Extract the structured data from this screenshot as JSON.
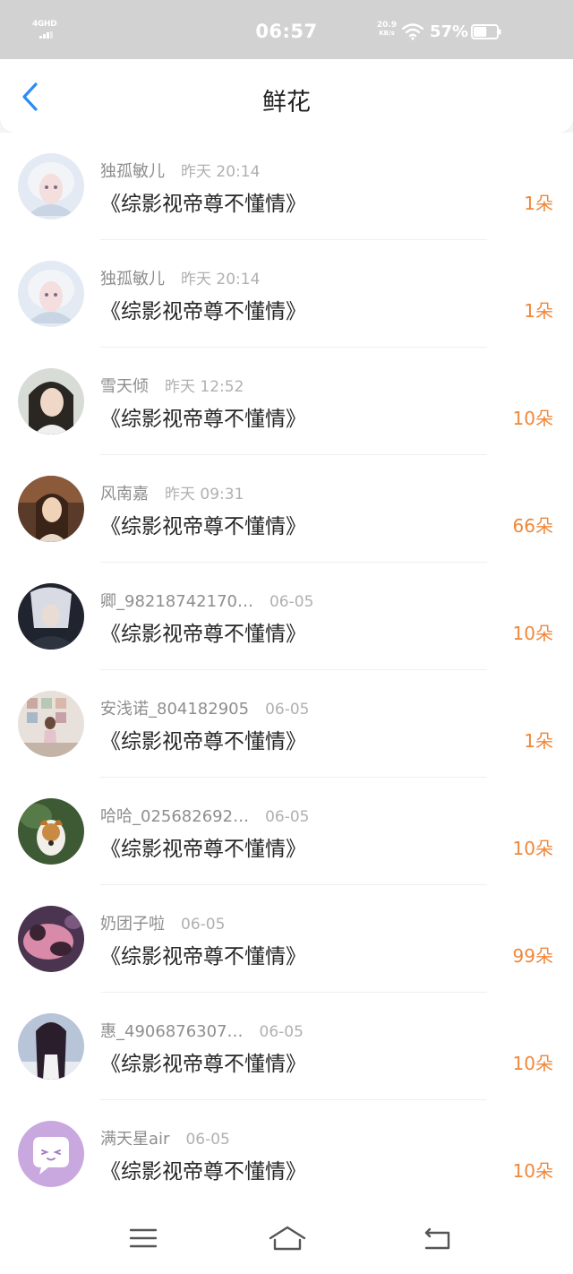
{
  "status_bar": {
    "network": "4GHD",
    "time": "06:57",
    "speed_value": "20.9",
    "speed_unit": "KB/s",
    "battery": "57%",
    "battery_level": 0.57
  },
  "header": {
    "title": "鲜花",
    "back_icon": "chevron-left-icon"
  },
  "colors": {
    "accent_blue": "#2b8cf3",
    "count_orange": "#f0873a"
  },
  "items": [
    {
      "name": "独孤敏儿",
      "time": "昨天 20:14",
      "book": "《综影视帝尊不懂情》",
      "count": "1朵"
    },
    {
      "name": "独孤敏儿",
      "time": "昨天 20:14",
      "book": "《综影视帝尊不懂情》",
      "count": "1朵"
    },
    {
      "name": "雪天倾",
      "time": "昨天 12:52",
      "book": "《综影视帝尊不懂情》",
      "count": "10朵"
    },
    {
      "name": "风南嘉",
      "time": "昨天 09:31",
      "book": "《综影视帝尊不懂情》",
      "count": "66朵"
    },
    {
      "name": "卿_98218742170…",
      "time": "06-05",
      "book": "《综影视帝尊不懂情》",
      "count": "10朵"
    },
    {
      "name": "安浅诺_804182905",
      "time": "06-05",
      "book": "《综影视帝尊不懂情》",
      "count": "1朵"
    },
    {
      "name": "哈哈_025682692…",
      "time": "06-05",
      "book": "《综影视帝尊不懂情》",
      "count": "10朵"
    },
    {
      "name": "奶团子啦",
      "time": "06-05",
      "book": "《综影视帝尊不懂情》",
      "count": "99朵"
    },
    {
      "name": "惠_4906876307…",
      "time": "06-05",
      "book": "《综影视帝尊不懂情》",
      "count": "10朵"
    },
    {
      "name": "满天星air",
      "time": "06-05",
      "book": "《综影视帝尊不懂情》",
      "count": "10朵"
    }
  ],
  "nav": {
    "menu_icon": "menu-icon",
    "home_icon": "home-icon",
    "back_icon": "back-icon"
  }
}
